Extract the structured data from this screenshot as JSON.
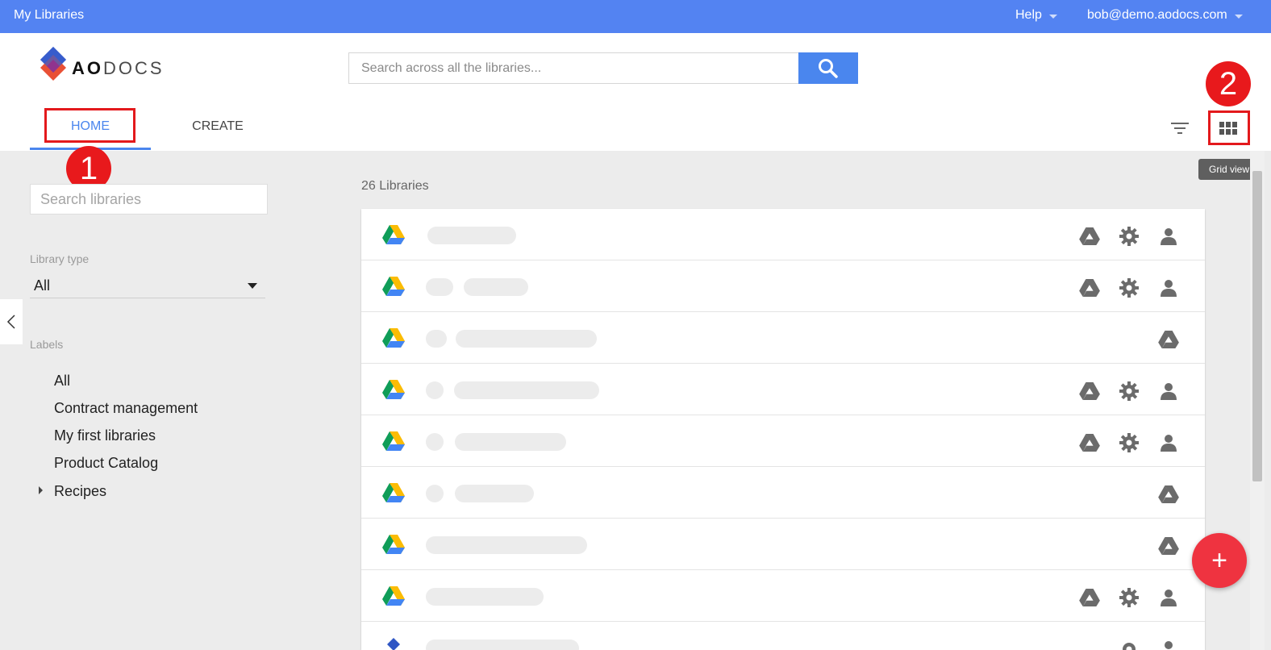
{
  "topbar": {
    "title": "My Libraries",
    "help_label": "Help",
    "user_label": "bob@demo.aodocs.com"
  },
  "logo": {
    "text_bold": "AO",
    "text_light": "DOCS"
  },
  "search": {
    "placeholder": "Search across all the libraries..."
  },
  "tabs": {
    "home": "HOME",
    "create": "CREATE"
  },
  "annotations": {
    "one": "1",
    "two": "2"
  },
  "toolbar": {
    "grid_tooltip": "Grid view"
  },
  "sidebar": {
    "search_placeholder": "Search libraries",
    "library_type_label": "Library type",
    "library_type_value": "All",
    "labels_heading": "Labels",
    "labels": [
      "All",
      "Contract management",
      "My first libraries",
      "Product Catalog",
      "Recipes"
    ]
  },
  "main": {
    "count_label": "26 Libraries",
    "rows": [
      {
        "actions": [
          "drive-icon",
          "gear-icon",
          "user-icon"
        ]
      },
      {
        "actions": [
          "drive-icon",
          "gear-icon",
          "user-icon"
        ]
      },
      {
        "actions": [
          "drive-icon"
        ]
      },
      {
        "actions": [
          "drive-icon",
          "gear-icon",
          "user-icon"
        ]
      },
      {
        "actions": [
          "drive-icon",
          "gear-icon",
          "user-icon"
        ]
      },
      {
        "actions": [
          "drive-icon"
        ]
      },
      {
        "actions": [
          "drive-icon"
        ]
      },
      {
        "actions": [
          "drive-icon",
          "gear-icon",
          "user-icon"
        ]
      }
    ]
  },
  "fab": {
    "label": "+"
  },
  "colors": {
    "topbar": "#5383f2",
    "accent": "#4a86ee",
    "annotation": "#e3191c",
    "fab": "#ef3340"
  }
}
